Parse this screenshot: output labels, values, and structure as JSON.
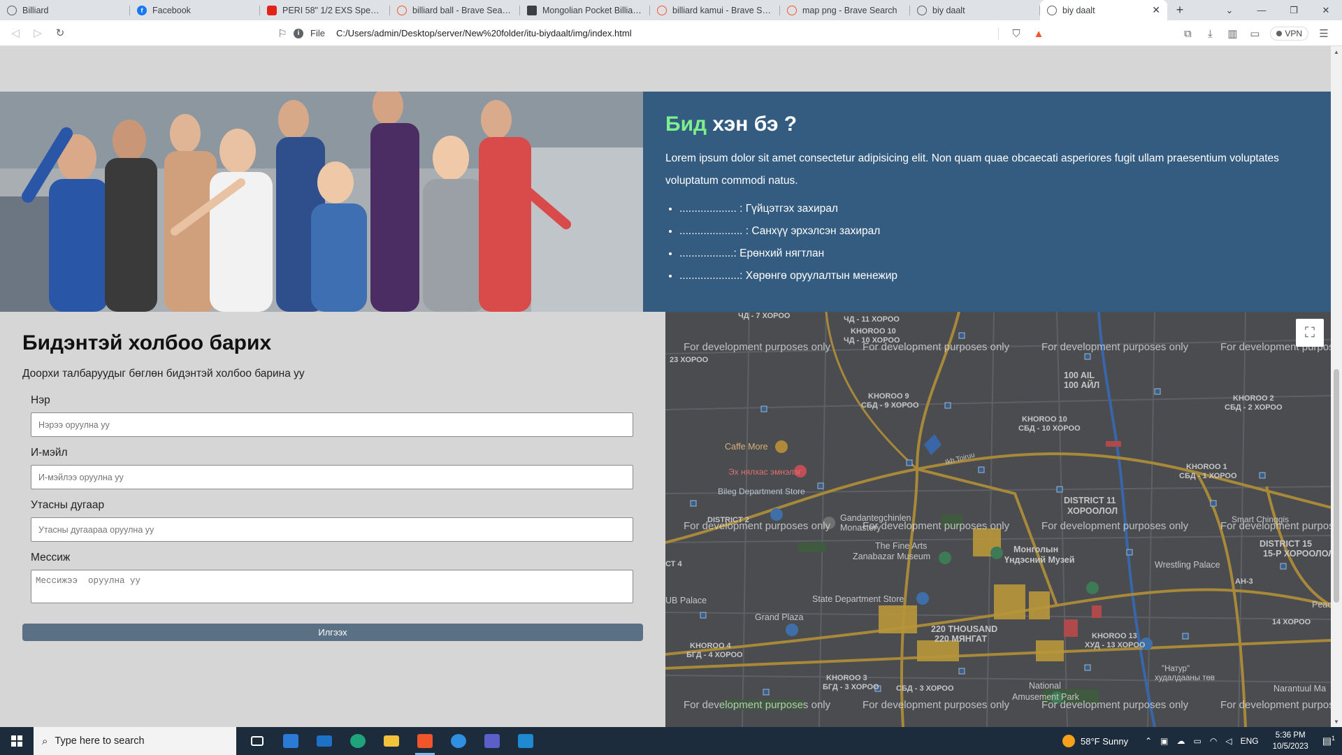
{
  "browser": {
    "tabs": [
      {
        "label": "Billiard",
        "favicon": "globe-icon"
      },
      {
        "label": "Facebook",
        "favicon": "facebook-icon"
      },
      {
        "label": "PERI 58\" 1/2 EXS Speed Bla",
        "favicon": "peri-icon"
      },
      {
        "label": "billiard ball - Brave Search",
        "favicon": "brave-search-icon"
      },
      {
        "label": "Mongolian Pocket Billiard A",
        "favicon": "site-icon"
      },
      {
        "label": "billiard kamui - Brave Searc",
        "favicon": "brave-search-icon"
      },
      {
        "label": "map png - Brave Search",
        "favicon": "brave-search-icon"
      },
      {
        "label": "biy daalt",
        "favicon": "globe-icon"
      }
    ],
    "active_tab": {
      "label": "biy daalt",
      "close": "✕"
    },
    "new_tab": "+",
    "address": {
      "scheme_label": "File",
      "url": "C:/Users/admin/Desktop/server/New%20folder/itu-biydaalt/img/index.html"
    },
    "vpn_label": "VPN"
  },
  "about": {
    "title_highlight": "Бид",
    "title_rest": " хэн бэ ?",
    "paragraph": "Lorem ipsum dolor sit amet consectetur adipisicing elit. Non quam quae obcaecati asperiores fugit ullam praesentium voluptates voluptatum commodi natus.",
    "items": [
      "................... : Гүйцэтгэх захирал",
      "..................... : Санхүү эрхэлсэн захирал",
      "..................: Ерөнхий нягтлан",
      "....................: Хөрөнгө оруулалтын менежир"
    ]
  },
  "contact": {
    "title": "Бидэнтэй холбоо барих",
    "subtitle": "Доорхи талбаруудыг бөглөн бидэнтэй холбоо барина уу",
    "name_label": "Нэр",
    "name_placeholder": "Нэрээ оруулна уу",
    "email_label": "И-мэйл",
    "email_placeholder": "И-мэйлээ оруулна уу",
    "phone_label": "Утасны дугаар",
    "phone_placeholder": "Утасны дугаараа оруулна уу",
    "message_label": "Мессиж",
    "message_placeholder": "Мессижээ  оруулна уу",
    "submit_label": "Илгээх"
  },
  "map": {
    "watermark": "For development purposes only",
    "labels": {
      "khoroo7": "ЧД - 7 ХОРОО",
      "khoroo11": "ЧД - 11 ХОРОО",
      "khoroo10a": "KHOROO 10",
      "khoroo10a_sub": "ЧД - 10 ХОРОО",
      "khoroo23": "23 ХОРОО",
      "ail100": "100 AIL",
      "ail100_sub": "100 АЙЛ",
      "khoroo2": "KHOROO 2",
      "khoroo2_sub": "СБД - 2 ХОРОО",
      "khoroo9": "KHOROO 9",
      "khoroo9_sub": "СБД - 9 ХОРОО",
      "khoroo10b": "KHOROO 10",
      "khoroo10b_sub": "СБД - 10 ХОРОО",
      "khoroo1": "KHOROO 1",
      "khoroo1_sub": "СБД - 1 ХОРОО",
      "cafe": "Caffe More",
      "ekh": "Эх нялхас эмнэлэг",
      "bileg": "Bileg Department Store",
      "gandan": "Gandantegchinlen",
      "monastery": "Monastery",
      "district11": "DISTRICT 11",
      "district11_sub": "ХОРООЛОЛ",
      "district15": "DISTRICT 15",
      "district15_sub": "15-Р ХОРООЛОЛ",
      "wrestling": "Wrestling Palace",
      "ah3": "АН-3",
      "finearts": "The Fine Arts",
      "zanabazar": "Zanabazar Museum",
      "mongol_museum": "Монголын",
      "mongol_museum_sub": "Үндэсний Музей",
      "statestore": "State Department Store",
      "grandplaza": "Grand Plaza",
      "ub_palace": "UB Palace",
      "thousand": "220 THOUSAND",
      "thousand_sub": "220 МЯНГАТ",
      "khoroo13": "KHOROO 13",
      "khoroo13_sub": "ХУД - 13 ХОРОО",
      "khoroo14": "14 ХОРОО",
      "khoroo4": "KHOROO 4",
      "khoroo4_sub": "БГД - 4 ХОРОО",
      "khoroo3": "KHOROO 3",
      "khoroo3_sub": "БГД - 3 ХОРОО",
      "khoroo3b": "СБД - 3 ХОРОО",
      "national": "National",
      "amusement": "Amusement Park",
      "natur": "\"Натур\"",
      "natur_sub": "худалдааны төв",
      "naran": "Narantuul Ma",
      "peace": "Peac",
      "smart": "Smart Chinggis",
      "ikh_toiruu": "Ikh Toiruu",
      "ct4": "СТ 4",
      "district2": "DISTRICT 2"
    }
  },
  "taskbar": {
    "search_placeholder": "Type here to search",
    "weather": "58°F  Sunny",
    "lang": "ENG",
    "time": "5:36 PM",
    "date": "10/5/2023",
    "notification_count": "1"
  }
}
